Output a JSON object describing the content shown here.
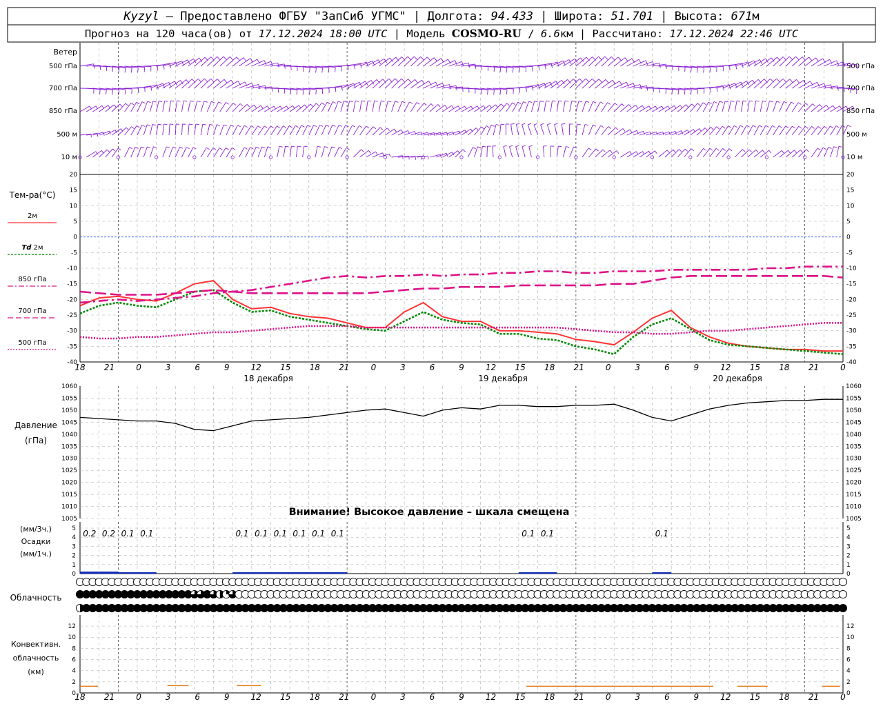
{
  "header": {
    "station": "Kyzyl",
    "line1_a": " – Предоставлено ФГБУ \"ЗапСиб УГМС\" | Долгота: ",
    "lon": "94.433",
    "line1_b": " | Широта: ",
    "lat": "51.701",
    "line1_c": " | Высота: ",
    "elev": "671",
    "elev_unit": "м",
    "line2_a": "Прогноз на 120 часа(ов) от ",
    "start": "17.12.2024 18:00 UTC",
    "line2_b": " | Модель ",
    "model": "COSMO-RU",
    "line2_c": " / ",
    "res": "6.6",
    "res_unit": "км",
    "line2_d": " | Рассчитано: ",
    "calc": "17.12.2024 22:46 UTC"
  },
  "axis": {
    "hour_labels": [
      "18",
      "21",
      "0",
      "3",
      "6",
      "9",
      "12",
      "15",
      "18",
      "21",
      "0",
      "3",
      "6",
      "9",
      "12",
      "15",
      "18",
      "21",
      "0",
      "3",
      "6",
      "9",
      "12",
      "15",
      "18",
      "21",
      "0"
    ],
    "date_labels": [
      "18 декабря",
      "19 декабря",
      "20 декабря"
    ]
  },
  "labels": {
    "wind": "Ветер",
    "wind_levels": [
      "500 гПа",
      "700 гПа",
      "850 гПа",
      "500 м",
      "10  м"
    ],
    "temp_title": "Тем-ра(°C)",
    "leg_2m": "2м",
    "leg_td": "Td",
    "leg_td2": "2м",
    "leg_850": "850 гПа",
    "leg_700": "700 гПа",
    "leg_500": "500 гПа",
    "press_title": "Давление",
    "press_unit": "(гПа)",
    "press_warning": "Внимание! Высокое давление – шкала смещена",
    "precip_u1": "(мм/3ч.)",
    "precip_title": "Осадки",
    "precip_u2": "(мм/1ч.)",
    "cloud_title": "Облачность",
    "conv_1": "Конвективн.",
    "conv_2": "облачность",
    "conv_3": "(км)"
  },
  "chart_data": [
    {
      "type": "line",
      "title": "Тем-ра(°C)",
      "ylim": [
        -40,
        20
      ],
      "yticks": [
        20,
        15,
        10,
        5,
        0,
        -5,
        -10,
        -15,
        -20,
        -25,
        -30,
        -35,
        -40
      ],
      "x_hours": [
        0,
        3,
        6,
        9,
        12,
        15,
        18,
        21,
        24,
        27,
        30,
        33,
        36,
        39,
        42,
        45,
        48,
        51,
        54,
        57,
        60,
        63,
        66,
        69,
        72,
        75,
        78,
        81,
        84,
        87,
        90,
        93,
        96,
        99,
        102,
        105,
        108,
        111,
        114,
        117,
        120
      ],
      "series": [
        {
          "name": "2м",
          "color": "#ff3333",
          "style": "solid",
          "values": [
            -22,
            -19.5,
            -19,
            -20,
            -20.5,
            -18,
            -15,
            -14,
            -20,
            -23,
            -22.5,
            -24.5,
            -25.5,
            -26,
            -27.5,
            -29,
            -29,
            -24,
            -21,
            -25.5,
            -27,
            -27,
            -30,
            -30,
            -30.5,
            -31,
            -32.8,
            -33.5,
            -34.5,
            -30.5,
            -26,
            -23.5,
            -29,
            -32,
            -34,
            -35,
            -35.5,
            -36,
            -36,
            -36.5,
            -36.5
          ]
        },
        {
          "name": "Td 2м",
          "color": "#008800",
          "style": "dotted",
          "values": [
            -24.5,
            -22,
            -21,
            -22,
            -22.5,
            -20,
            -17.5,
            -17,
            -21,
            -24,
            -23.5,
            -25.5,
            -26.5,
            -27.5,
            -28.5,
            -29.5,
            -30,
            -27,
            -24,
            -26.5,
            -27.5,
            -28,
            -31,
            -31,
            -32.5,
            -33,
            -35,
            -36,
            -37.5,
            -32,
            -28,
            -26,
            -29.5,
            -33,
            -34.5,
            -35,
            -35.5,
            -36,
            -36.5,
            -37,
            -37.5
          ]
        },
        {
          "name": "850 гПа",
          "color": "#dd1188",
          "style": "dashdot",
          "values": [
            -21,
            -20.5,
            -20,
            -20.5,
            -20,
            -19.5,
            -19,
            -18,
            -17.5,
            -17,
            -16,
            -15,
            -14,
            -13,
            -12.5,
            -13,
            -12.5,
            -12.5,
            -12,
            -12.5,
            -12,
            -12,
            -11.5,
            -11.5,
            -11,
            -11,
            -11.5,
            -11.5,
            -11,
            -11,
            -11,
            -10.5,
            -10.5,
            -10.5,
            -10.5,
            -10.5,
            -10,
            -10,
            -9.5,
            -9.5,
            -9.5
          ]
        },
        {
          "name": "700 гПа",
          "color": "#dd1188",
          "style": "dashed",
          "values": [
            -17.5,
            -18,
            -18.5,
            -18.5,
            -18.5,
            -18,
            -17.5,
            -17,
            -17.5,
            -18,
            -18,
            -18,
            -18,
            -18,
            -18,
            -18,
            -17.5,
            -17,
            -16.5,
            -16.5,
            -16,
            -16,
            -16,
            -15.5,
            -15.5,
            -15.5,
            -15.5,
            -15.5,
            -15,
            -15,
            -14,
            -13,
            -12.5,
            -12.5,
            -12.5,
            -12.5,
            -12.5,
            -12.5,
            -12.5,
            -12.5,
            -13
          ]
        },
        {
          "name": "500 гПа",
          "color": "#dd1188",
          "style": "dotted",
          "values": [
            -32,
            -32.5,
            -32.5,
            -32,
            -32,
            -31.5,
            -31,
            -30.5,
            -30.5,
            -30,
            -29.5,
            -29,
            -28.5,
            -28.5,
            -28.5,
            -29,
            -29,
            -29,
            -29,
            -29,
            -29,
            -29,
            -29,
            -29,
            -29,
            -29,
            -29.5,
            -30,
            -30.5,
            -30.5,
            -31,
            -31,
            -30.5,
            -30,
            -30,
            -29.5,
            -29,
            -28.5,
            -28,
            -27.5,
            -27.5
          ]
        }
      ]
    },
    {
      "type": "line",
      "title": "Давление",
      "ylabel": "(гПа)",
      "ylim": [
        1005,
        1060
      ],
      "yticks": [
        1060,
        1055,
        1050,
        1045,
        1040,
        1035,
        1030,
        1025,
        1020,
        1015,
        1010,
        1005
      ],
      "x_hours": [
        0,
        3,
        6,
        9,
        12,
        15,
        18,
        21,
        24,
        27,
        30,
        33,
        36,
        39,
        42,
        45,
        48,
        51,
        54,
        57,
        60,
        63,
        66,
        69,
        72,
        75,
        78,
        81,
        84,
        87,
        90,
        93,
        96,
        99,
        102,
        105,
        108,
        111,
        114,
        117,
        120
      ],
      "series": [
        {
          "name": "Давление",
          "color": "#000000",
          "values": [
            1047,
            1046.5,
            1046,
            1045.5,
            1045.5,
            1044.5,
            1042,
            1041.5,
            1043.5,
            1045.5,
            1046,
            1046.5,
            1047,
            1048,
            1049,
            1050,
            1050.5,
            1049,
            1047.5,
            1050,
            1051,
            1050.5,
            1052,
            1052,
            1051.5,
            1051.5,
            1052,
            1052,
            1052.5,
            1050,
            1047,
            1045.5,
            1048,
            1050.5,
            1052,
            1053,
            1053.5,
            1054,
            1054,
            1054.5,
            1054.5
          ]
        }
      ]
    },
    {
      "type": "bar",
      "title": "Осадки",
      "ylim": [
        0,
        5
      ],
      "yticks": [
        5,
        4,
        3,
        2,
        1,
        0
      ],
      "x_hours_3h": [
        1.5,
        4.5,
        7.5,
        10.5,
        13.5,
        16.5,
        19.5,
        22.5,
        25.5,
        28.5,
        31.5,
        34.5,
        37.5,
        40.5,
        43.5,
        46.5,
        49.5,
        52.5,
        55.5,
        58.5,
        61.5,
        64.5,
        67.5,
        70.5,
        73.5,
        76.5,
        79.5,
        82.5,
        85.5,
        88.5,
        91.5,
        94.5,
        97.5,
        100.5,
        103.5,
        106.5,
        109.5,
        112.5,
        115.5,
        118.5
      ],
      "values_3h": [
        0.2,
        0.2,
        0.1,
        0.1,
        0,
        0,
        0,
        0,
        0.1,
        0.1,
        0.1,
        0.1,
        0.1,
        0.1,
        0,
        0,
        0,
        0,
        0,
        0,
        0,
        0,
        0,
        0.1,
        0.1,
        0,
        0,
        0,
        0,
        0,
        0.1,
        0,
        0,
        0,
        0,
        0,
        0,
        0,
        0,
        0
      ],
      "labels_3h": [
        "0.2",
        "0.2",
        "0.1",
        "0.1",
        "",
        "",
        "",
        "",
        "0.1",
        "0.1",
        "0.1",
        "0.1",
        "0.1",
        "0.1",
        "",
        "",
        "",
        "",
        "",
        "",
        "",
        "",
        "",
        "0.1",
        "0.1",
        "",
        "",
        "",
        "",
        "",
        "0.1",
        "",
        "",
        "",
        "",
        "",
        "",
        "",
        "",
        ""
      ]
    },
    {
      "type": "bar",
      "title": "Конвективн. облачность (км)",
      "ylim": [
        0,
        13
      ],
      "yticks": [
        12,
        10,
        8,
        6,
        4,
        2,
        0
      ]
    }
  ],
  "clouds": {
    "upper": "0000000000000000000000000000000000000000000000000000000000000000000000000000000000000000000000000000000000000000000000000",
    "middle": "4444444444444444443343213000000000000000000000000000000000000000000000000000000000000000000000000000000000000000000000000",
    "lower": "2444444444444444444444444444444444444444444444444444444444444444444444444444444444444444444444444444444444444444444444444"
  },
  "conv_cloud": {
    "color": "#e07a10",
    "segments": [
      [
        0,
        3,
        1.2
      ],
      [
        14.5,
        18,
        1.3
      ],
      [
        26,
        30,
        1.3
      ],
      [
        74,
        83,
        1.2
      ],
      [
        83,
        105,
        1.2
      ],
      [
        109,
        114,
        1.2
      ],
      [
        123,
        126,
        1.2
      ]
    ]
  },
  "colors": {
    "wind": "#8a1fd6",
    "t2m": "#ff3333",
    "td": "#008800",
    "tp": "#dd1188",
    "zero": "#3355ff",
    "precip": "#1030c0",
    "grid": "#aaaaaa"
  }
}
